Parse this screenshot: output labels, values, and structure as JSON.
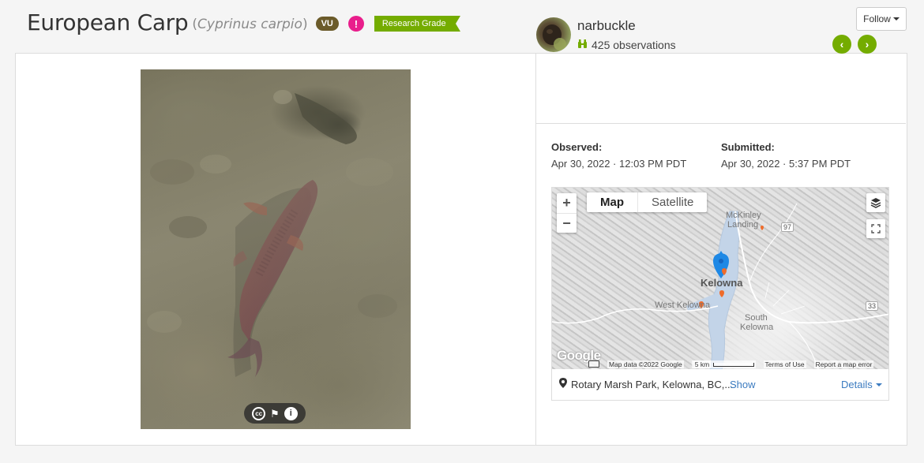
{
  "header": {
    "common_name": "European Carp",
    "scientific_open": "(",
    "scientific_name": "Cyprinus carpio",
    "scientific_close": ")",
    "conservation_status": "VU",
    "alert_glyph": "!",
    "quality_grade": "Research Grade",
    "follow_label": "Follow"
  },
  "photo": {
    "cc_label": "cc",
    "info_glyph": "i"
  },
  "observer": {
    "username": "narbuckle",
    "observations": "425 observations"
  },
  "nav": {
    "prev_glyph": "‹",
    "next_glyph": "›"
  },
  "dates": {
    "observed_label": "Observed:",
    "observed_value": "Apr 30, 2022 · 12:03 PM PDT",
    "submitted_label": "Submitted:",
    "submitted_value": "Apr 30, 2022 · 5:37 PM PDT"
  },
  "map": {
    "type_map": "Map",
    "type_satellite": "Satellite",
    "zoom_in": "+",
    "zoom_out": "−",
    "labels": {
      "mckinley": "McKinley",
      "landing": "Landing",
      "kelowna": "Kelowna",
      "west_kelowna": "West Kelowna",
      "south": "South",
      "south_kelowna": "Kelowna",
      "hwy97": "97",
      "hwy33": "33"
    },
    "google_logo": "Google",
    "attribution": {
      "map_data": "Map data ©2022 Google",
      "scale": "5 km",
      "terms": "Terms of Use",
      "report": "Report a map error"
    }
  },
  "location": {
    "place": "Rotary Marsh Park, Kelowna, BC,...",
    "show_label": "Show",
    "details_label": "Details"
  },
  "colors": {
    "accent_green": "#74ac00",
    "vu_badge": "#6b5b2a",
    "alert_pink": "#e91e8c",
    "link_blue": "#3b7bc0",
    "pin_blue": "#1e88e5"
  }
}
